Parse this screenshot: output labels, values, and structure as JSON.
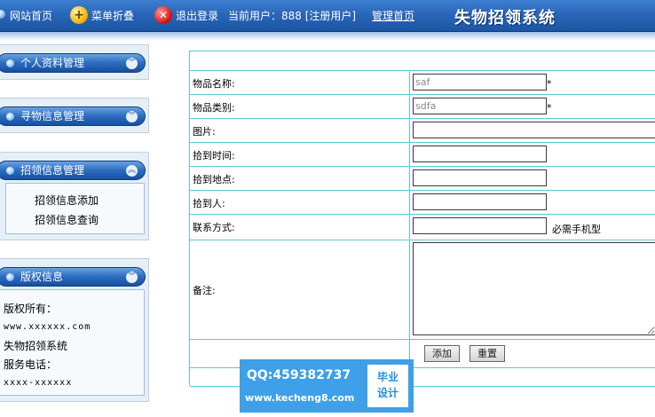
{
  "topbar": {
    "home_label": "网站首页",
    "collapse_label": "菜单折叠",
    "logout_label": "退出登录",
    "current_user_label": "当前用户：888 [注册用户]",
    "admin_home_label": "管理首页",
    "system_title": "失物招领系统"
  },
  "sidebar": {
    "profile_header": "个人资料管理",
    "search_header": "寻物信息管理",
    "claim_header": "招领信息管理",
    "claim_items": [
      "招领信息添加",
      "招领信息查询"
    ],
    "copyright_header": "版权信息",
    "copyright_lines": [
      "版权所有：",
      "www.xxxxxx.com",
      "失物招领系统",
      "服务电话：",
      "xxxx-xxxxxx"
    ]
  },
  "form": {
    "item_name_label": "物品名称:",
    "item_name_value": "saf",
    "item_category_label": "物品类别:",
    "item_category_value": "sdfa",
    "required_mark": "*",
    "image_label": "图片:",
    "found_time_label": "拾到时间:",
    "found_place_label": "拾到地点:",
    "finder_label": "拾到人:",
    "contact_label": "联系方式:",
    "contact_note": "必需手机型",
    "remark_label": "备注:",
    "add_button": "添加",
    "reset_button": "重置"
  },
  "watermark": {
    "qq": "QQ:459382737",
    "site": "www.kecheng8.com",
    "badge_line1": "毕业",
    "badge_line2": "设计"
  }
}
